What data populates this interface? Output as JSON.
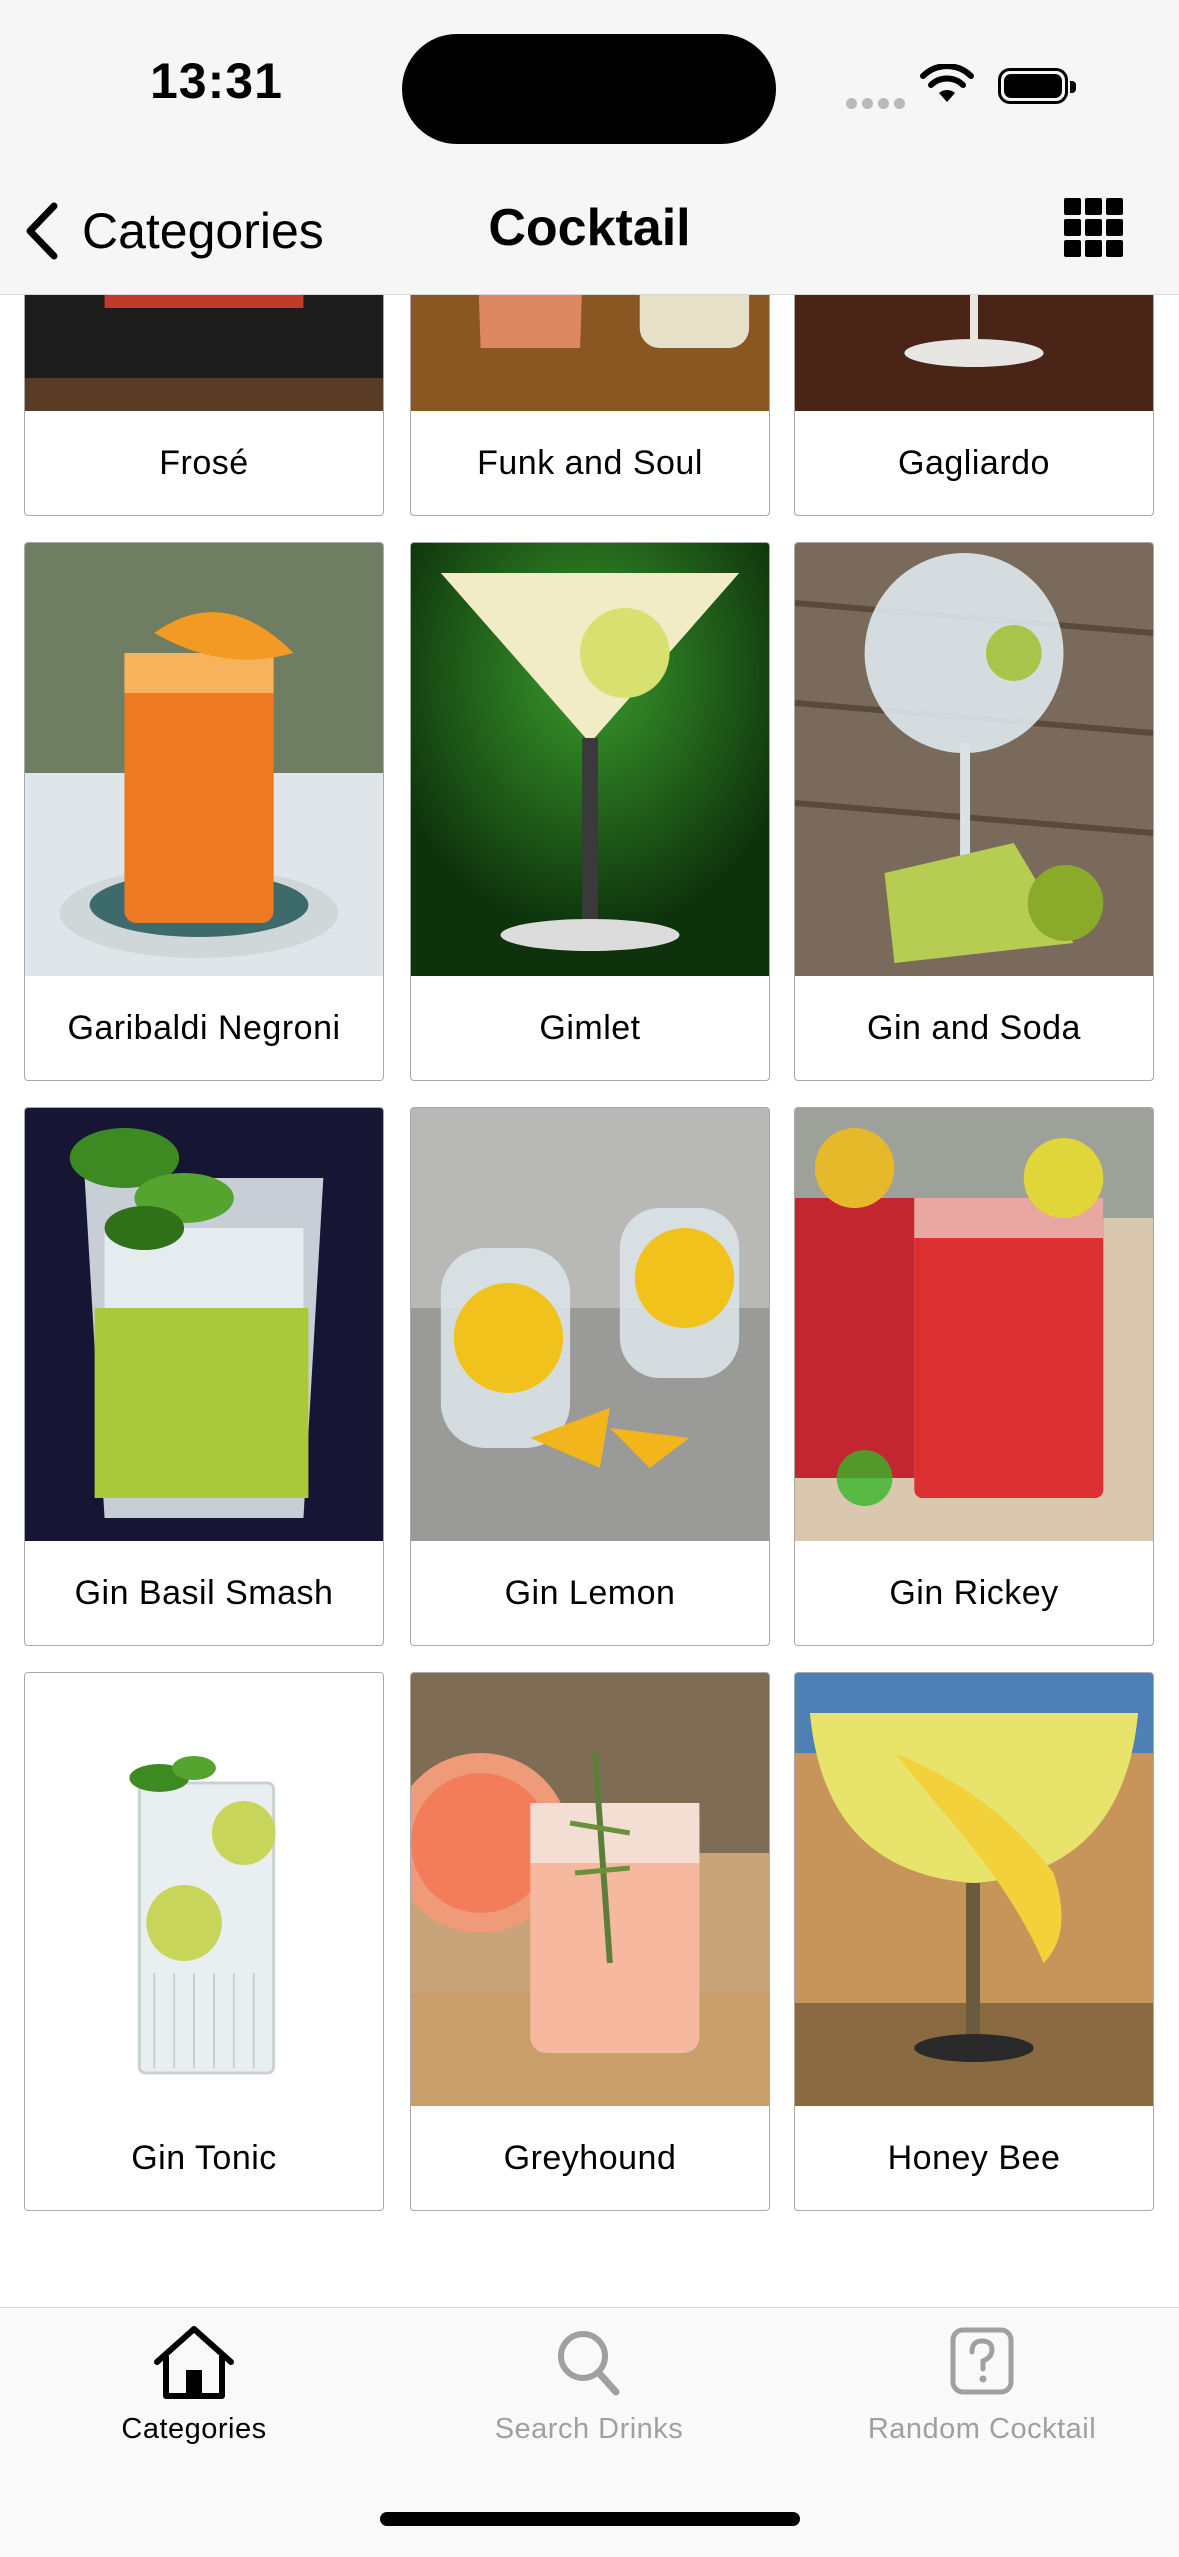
{
  "status_bar": {
    "time": "13:31"
  },
  "nav": {
    "back_label": "Categories",
    "title": "Cocktail"
  },
  "drinks": [
    {
      "name": "Frosé",
      "art": "frose"
    },
    {
      "name": "Funk and Soul",
      "art": "funk"
    },
    {
      "name": "Gagliardo",
      "art": "gagliardo"
    },
    {
      "name": "Garibaldi Negroni",
      "art": "garibaldi"
    },
    {
      "name": "Gimlet",
      "art": "gimlet"
    },
    {
      "name": "Gin and Soda",
      "art": "ginsoda"
    },
    {
      "name": "Gin Basil Smash",
      "art": "basil"
    },
    {
      "name": "Gin Lemon",
      "art": "lemon"
    },
    {
      "name": "Gin Rickey",
      "art": "rickey"
    },
    {
      "name": "Gin Tonic",
      "art": "tonic"
    },
    {
      "name": "Greyhound",
      "art": "greyhound"
    },
    {
      "name": "Honey Bee",
      "art": "honeybee"
    }
  ],
  "tabs": [
    {
      "label": "Categories",
      "icon": "house-icon",
      "active": true
    },
    {
      "label": "Search Drinks",
      "icon": "magnifier-icon",
      "active": false
    },
    {
      "label": "Random Cocktail",
      "icon": "question-square-icon",
      "active": false
    }
  ]
}
